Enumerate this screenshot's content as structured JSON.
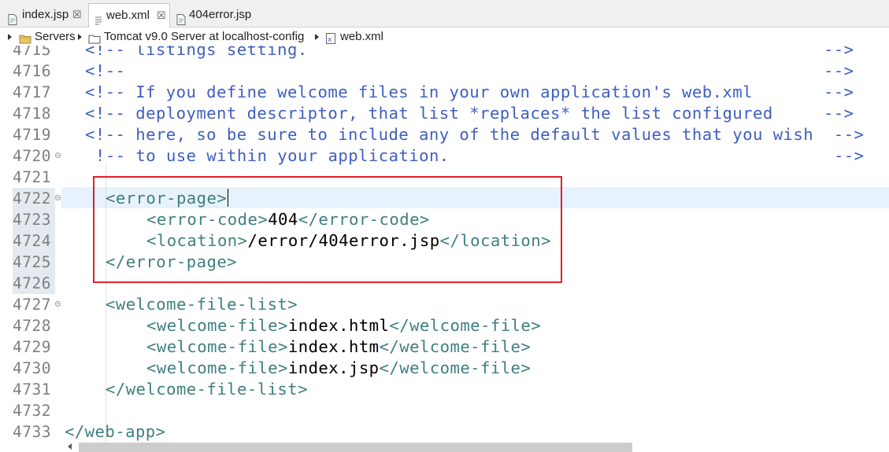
{
  "tabs": [
    {
      "label": "index.jsp",
      "close": "☒",
      "icon": "jsp-file-icon"
    },
    {
      "label": "web.xml",
      "close": "☒",
      "icon": "xml-file-icon"
    },
    {
      "label": "404error.jsp",
      "close": "",
      "icon": "jsp-file-icon"
    }
  ],
  "breadcrumb": {
    "items": [
      "Servers",
      "Tomcat v9.0 Server at localhost-config",
      "web.xml"
    ]
  },
  "editor": {
    "current_line": "4722",
    "lines": [
      {
        "n": "4715",
        "text": "<!-- listings setting.                                                   -->"
      },
      {
        "n": "4716",
        "text": "<!--                                                                     -->"
      },
      {
        "n": "4717",
        "text": "<!-- If you define welcome files in your own application's web.xml       -->"
      },
      {
        "n": "4718",
        "text": "<!-- deployment descriptor, that list *replaces* the list configured     -->"
      },
      {
        "n": "4719",
        "text": "<!-- here, so be sure to include any of the default values that you wish  -->"
      },
      {
        "n": "4720",
        "text": "!-- to use within your application.                                      -->"
      },
      {
        "n": "4721",
        "text": ""
      },
      {
        "n": "4722",
        "open": "<error-page>",
        "value": "",
        "close": ""
      },
      {
        "n": "4723",
        "open": "<error-code>",
        "value": "404",
        "close": "</error-code>"
      },
      {
        "n": "4724",
        "open": "<location>",
        "value": "/error/404error.jsp",
        "close": "</location>"
      },
      {
        "n": "4725",
        "open": "</error-page>",
        "value": "",
        "close": ""
      },
      {
        "n": "4726",
        "text": ""
      },
      {
        "n": "4727",
        "open": "<welcome-file-list>",
        "value": "",
        "close": ""
      },
      {
        "n": "4728",
        "open": "<welcome-file>",
        "value": "index.html",
        "close": "</welcome-file>"
      },
      {
        "n": "4729",
        "open": "<welcome-file>",
        "value": "index.htm",
        "close": "</welcome-file>"
      },
      {
        "n": "4730",
        "open": "<welcome-file>",
        "value": "index.jsp",
        "close": "</welcome-file>"
      },
      {
        "n": "4731",
        "open": "</welcome-file-list>",
        "value": "",
        "close": ""
      },
      {
        "n": "4732",
        "text": ""
      },
      {
        "n": "4733",
        "open": "</web-app>",
        "value": "",
        "close": ""
      }
    ]
  },
  "colors": {
    "comment": "#3f5fbf",
    "tag": "#3f7f7f",
    "text": "#000000",
    "highlight_box": "#e0202a",
    "current_line_bg": "#e8f2fe"
  }
}
